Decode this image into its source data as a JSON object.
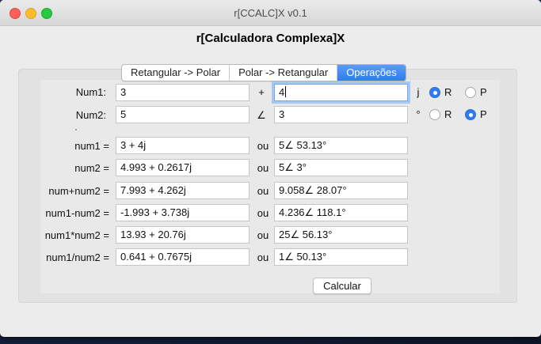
{
  "window": {
    "title": "r[CCALC]X v0.1"
  },
  "heading": "r[Calculadora Complexa]X",
  "tabs": [
    {
      "label": "Retangular -> Polar",
      "active": false
    },
    {
      "label": "Polar -> Retangular",
      "active": false
    },
    {
      "label": "Operações",
      "active": true
    }
  ],
  "inputs": {
    "num1_label": "Num1:",
    "num1_real": "3",
    "num1_operator": "+",
    "num1_imag": "4",
    "num1_unit": "j",
    "num2_label": "Num2:",
    "num2_mag": "5",
    "num2_operator": "∠",
    "num2_angle": "3",
    "num2_unit": "°"
  },
  "radios": {
    "num1_r_label": "R",
    "num1_r_selected": true,
    "num1_p_label": "P",
    "num1_p_selected": false,
    "num2_r_label": "R",
    "num2_r_selected": false,
    "num2_p_label": "P",
    "num2_p_selected": true
  },
  "results": [
    {
      "label": "num1 =",
      "rect": "3 + 4j",
      "or": "ou",
      "polar": "5∠ 53.13°"
    },
    {
      "label": "num2 =",
      "rect": "4.993 + 0.2617j",
      "or": "ou",
      "polar": "5∠ 3°"
    },
    {
      "label": "num+num2 =",
      "rect": "7.993 + 4.262j",
      "or": "ou",
      "polar": "9.058∠ 28.07°"
    },
    {
      "label": "num1-num2 =",
      "rect": "-1.993 + 3.738j",
      "or": "ou",
      "polar": "4.236∠ 118.1°"
    },
    {
      "label": "num1*num2 =",
      "rect": "13.93 + 20.76j",
      "or": "ou",
      "polar": "25∠ 56.13°"
    },
    {
      "label": "num1/num2 =",
      "rect": "0.641 + 0.7675j",
      "or": "ou",
      "polar": "1∠ 50.13°"
    }
  ],
  "button": {
    "calculate": "Calcular"
  },
  "colors": {
    "accent": "#2f7bf0",
    "focus_ring": "#a6c6f4"
  }
}
